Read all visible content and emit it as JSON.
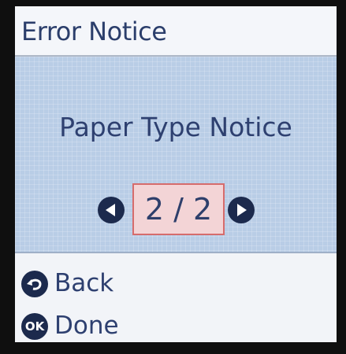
{
  "header": {
    "title": "Error Notice"
  },
  "main": {
    "notice": "Paper Type Notice",
    "pager": {
      "current": "2",
      "separator": "/",
      "total": "2"
    }
  },
  "footer": {
    "back": {
      "label": "Back",
      "icon": "back-arrow-icon"
    },
    "done": {
      "label": "Done",
      "icon": "ok-icon",
      "icon_text": "OK"
    }
  },
  "colors": {
    "header_bg": "#f4f6fa",
    "main_bg": "#b9cde6",
    "accent_dark": "#1c2a4d",
    "highlight_border": "#d66c6c",
    "highlight_bg": "#f3d4d6",
    "text": "#2e4070"
  }
}
